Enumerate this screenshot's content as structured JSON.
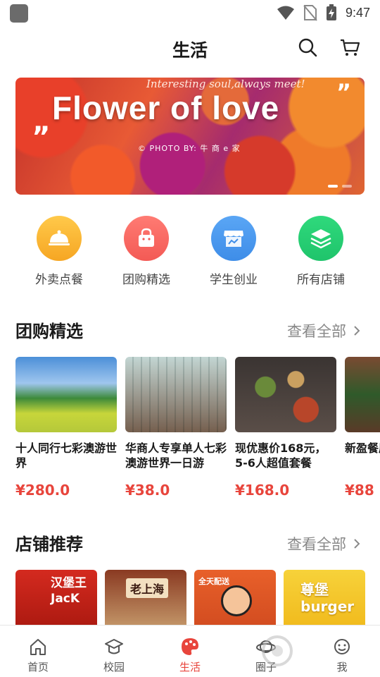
{
  "status_bar": {
    "time": "9:47"
  },
  "header": {
    "title": "生活"
  },
  "banner": {
    "subtitle": "Interesting soul,always meet!",
    "title": "Flower of love",
    "credit": "© PHOTO BY: 牛 商 e 家"
  },
  "categories": [
    {
      "label": "外卖点餐",
      "icon": "food-cloche-icon",
      "color": "#f6a623"
    },
    {
      "label": "团购精选",
      "icon": "shopping-bag-icon",
      "color": "#f35a55"
    },
    {
      "label": "学生创业",
      "icon": "storefront-icon",
      "color": "#3e8de8"
    },
    {
      "label": "所有店铺",
      "icon": "layers-icon",
      "color": "#1fc46b"
    }
  ],
  "group_buy": {
    "title": "团购精选",
    "more": "查看全部",
    "items": [
      {
        "name": "十人同行七彩澳游世界",
        "price": "¥280.0"
      },
      {
        "name": "华商人专享单人七彩澳游世界一日游",
        "price": "¥38.0"
      },
      {
        "name": "现优惠价168元，5-6人超值套餐",
        "price": "¥168.0"
      },
      {
        "name": "新盈餐原",
        "price": "¥88"
      }
    ]
  },
  "stores": {
    "title": "店铺推荐",
    "more": "查看全部",
    "items": [
      {
        "text": "汉堡王 JacK"
      },
      {
        "text": "老上海"
      },
      {
        "text": "全天配送"
      },
      {
        "text": "尊堡 burger"
      }
    ]
  },
  "nav": {
    "items": [
      {
        "label": "首页"
      },
      {
        "label": "校园"
      },
      {
        "label": "生活"
      },
      {
        "label": "圈子"
      },
      {
        "label": "我"
      }
    ],
    "active": "生活"
  },
  "colors": {
    "accent": "#e8453c"
  }
}
